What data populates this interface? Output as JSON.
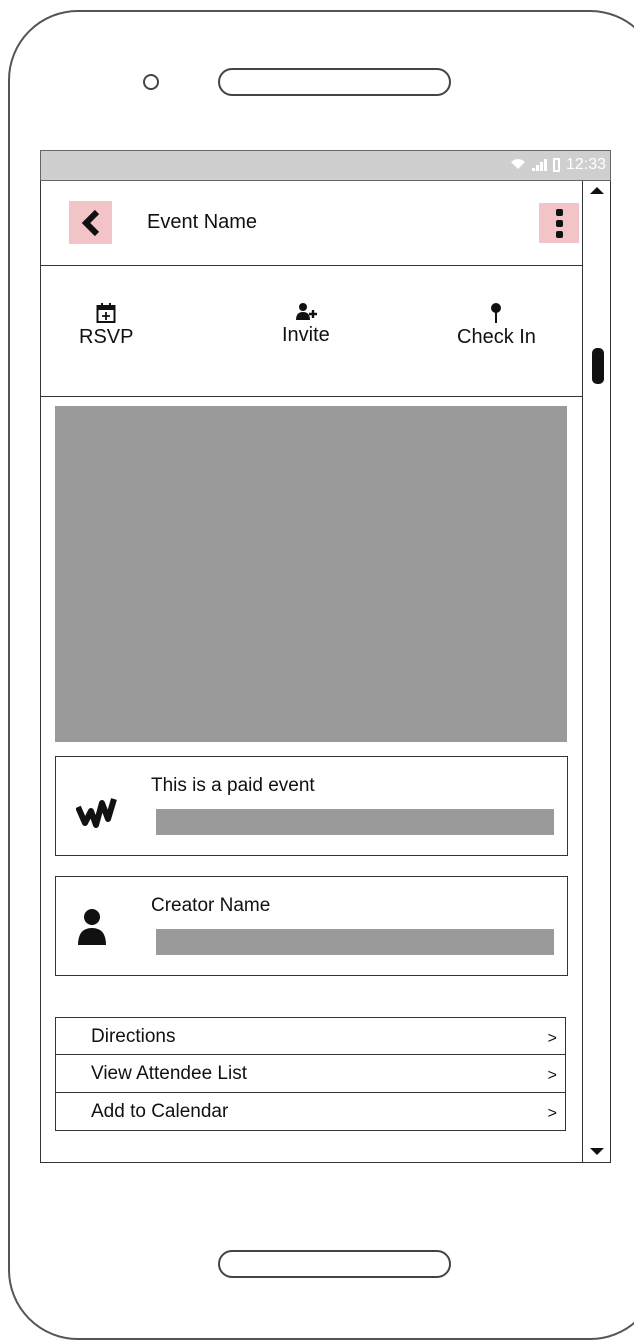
{
  "status": {
    "time": "12:33"
  },
  "header": {
    "title": "Event Name",
    "back_color": "#f2c4c7"
  },
  "actions": [
    {
      "label": "RSVP",
      "icon": "calendar-plus-icon"
    },
    {
      "label": "Invite",
      "icon": "add-user-icon"
    },
    {
      "label": "Check In",
      "icon": "pin-icon"
    }
  ],
  "paid_card": {
    "title": "This is a paid event",
    "icon": "money-logo-icon"
  },
  "creator_card": {
    "title": "Creator Name",
    "icon": "user-icon"
  },
  "links": [
    {
      "label": "Directions",
      "chevron": ">"
    },
    {
      "label": "View Attendee List",
      "chevron": ">"
    },
    {
      "label": "Add to Calendar",
      "chevron": ">"
    }
  ]
}
